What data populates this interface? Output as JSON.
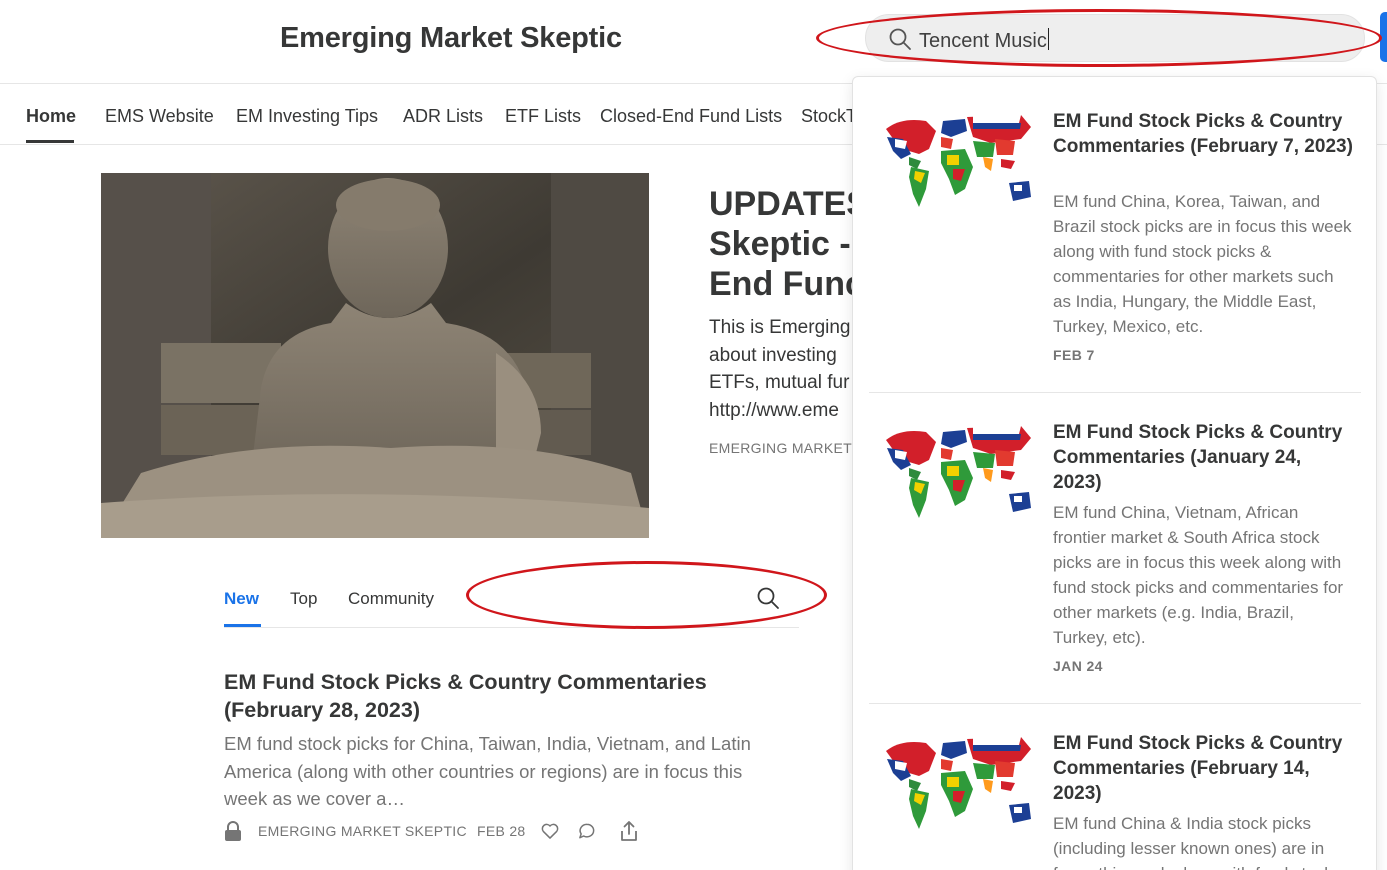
{
  "header": {
    "site_title": "Emerging Market Skeptic",
    "search_value": "Tencent Music"
  },
  "nav": {
    "items": [
      {
        "label": "Home",
        "active": true
      },
      {
        "label": "EMS Website"
      },
      {
        "label": "EM Investing Tips"
      },
      {
        "label": "ADR Lists"
      },
      {
        "label": "ETF Lists"
      },
      {
        "label": "Closed-End Fund Lists"
      },
      {
        "label": "StockT"
      }
    ]
  },
  "hero": {
    "title_lines": [
      "UPDATES",
      "Skeptic -",
      "End Func"
    ],
    "body_lines": [
      "This is Emerging",
      "about investing",
      "ETFs, mutual fur",
      "http://www.eme"
    ],
    "byline": "EMERGING MARKET"
  },
  "feed": {
    "tabs": [
      {
        "label": "New",
        "active": true
      },
      {
        "label": "Top"
      },
      {
        "label": "Community"
      }
    ]
  },
  "post": {
    "title": "EM Fund Stock Picks & Country Commentaries (February 28, 2023)",
    "description": "EM fund stock picks for China, Taiwan, India, Vietnam, and Latin America (along with other countries or regions) are in focus this week as we cover a…",
    "author": "EMERGING MARKET SKEPTIC",
    "date": "FEB 28"
  },
  "search_results": [
    {
      "title": "EM Fund Stock Picks & Country Commentaries (February 7, 2023)",
      "description": "EM fund China, Korea, Taiwan, and Brazil stock picks are in focus this week along with fund stock picks & commentaries for other markets such as India, Hungary, the Middle East, Turkey, Mexico, etc.",
      "date": "FEB 7"
    },
    {
      "title": "EM Fund Stock Picks & Country Commentaries (January 24, 2023)",
      "description": "EM fund China, Vietnam, African frontier market & South Africa stock picks are in focus this week along with fund stock picks and commentaries for other markets (e.g. India, Brazil, Turkey, etc).",
      "date": "JAN 24"
    },
    {
      "title": "EM Fund Stock Picks & Country Commentaries (February 14, 2023)",
      "description": "EM fund China & India stock picks (including lesser known ones) are in focus this week along with fund stock picks and commentaries.",
      "date": ""
    }
  ],
  "colors": {
    "accent": "#1a73e8",
    "annotation": "#d0161b",
    "text": "#363737",
    "muted": "#757575"
  },
  "icons": {
    "search": "search-icon",
    "lock": "lock-icon",
    "like": "heart-icon",
    "comment": "comment-icon",
    "share": "share-icon"
  }
}
